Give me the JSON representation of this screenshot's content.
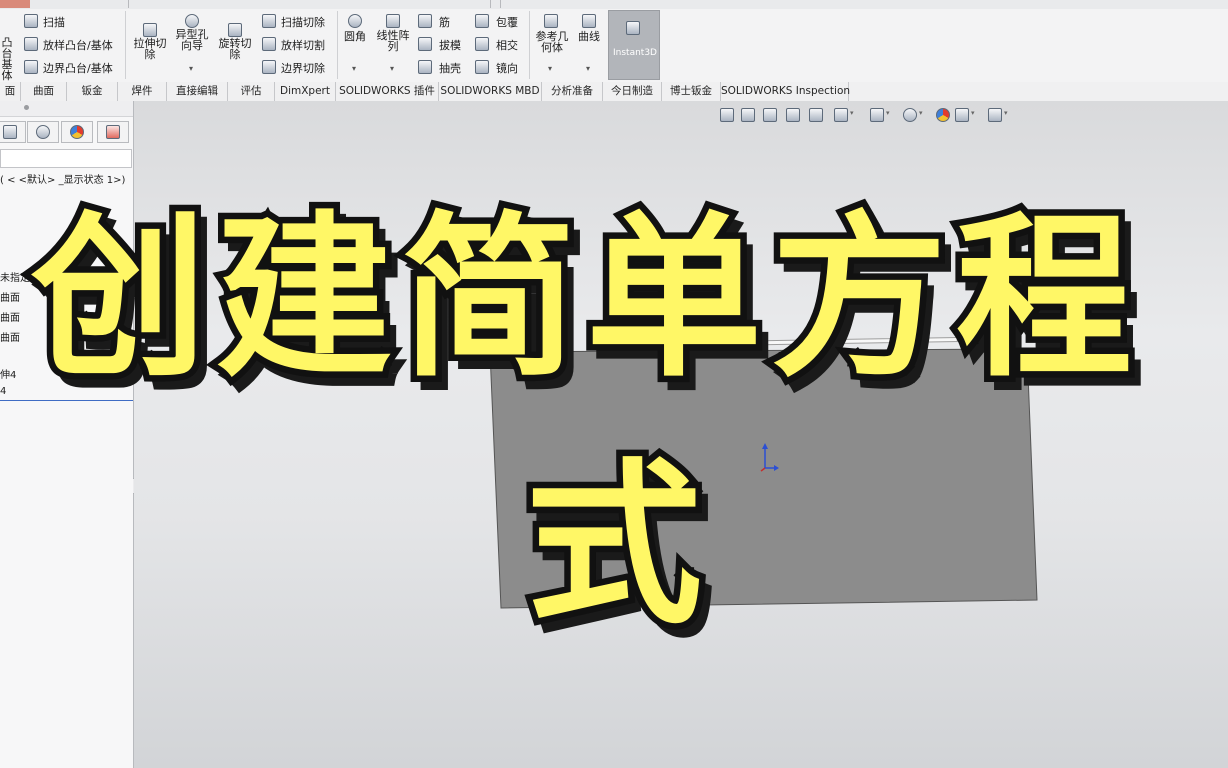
{
  "ribbon": {
    "items_small_col1": [
      "扫描",
      "放样凸台/基体",
      "边界凸台/基体"
    ],
    "partial_left": [
      "凸台",
      "基体"
    ],
    "big_extrude_cut": "拉伸切除",
    "big_hole_wizard": "异型孔向导",
    "big_revolve_cut": "旋转切除",
    "items_small_col2": [
      "扫描切除",
      "放样切割",
      "边界切除"
    ],
    "big_fillet": "圆角",
    "big_linear_pattern": "线性阵列",
    "items_small_col3": [
      "筋",
      "拔模",
      "抽壳"
    ],
    "items_small_col4": [
      "包覆",
      "相交",
      "镜向"
    ],
    "big_ref_geometry": "参考几何体",
    "big_curves": "曲线",
    "instant3d": "Instant3D"
  },
  "tabs": [
    "面",
    "曲面",
    "钣金",
    "焊件",
    "直接编辑",
    "评估",
    "DimXpert",
    "SOLIDWORKS 插件",
    "SOLIDWORKS MBD",
    "分析准备",
    "今日制造",
    "博士钣金",
    "SOLIDWORKS Inspection"
  ],
  "tree": {
    "config": "( < <默认> _显示状态 1>)",
    "items": [
      "未指定",
      "曲面",
      "曲面",
      "曲面",
      "伸4",
      "4"
    ]
  },
  "overlay": {
    "line1": "创建简单方程",
    "line2": "式"
  },
  "colors": {
    "title_fill": "#fff766",
    "title_outline": "#111111",
    "part_face": "#8c8c8c",
    "instant3d_active": "#b2b5ba"
  }
}
